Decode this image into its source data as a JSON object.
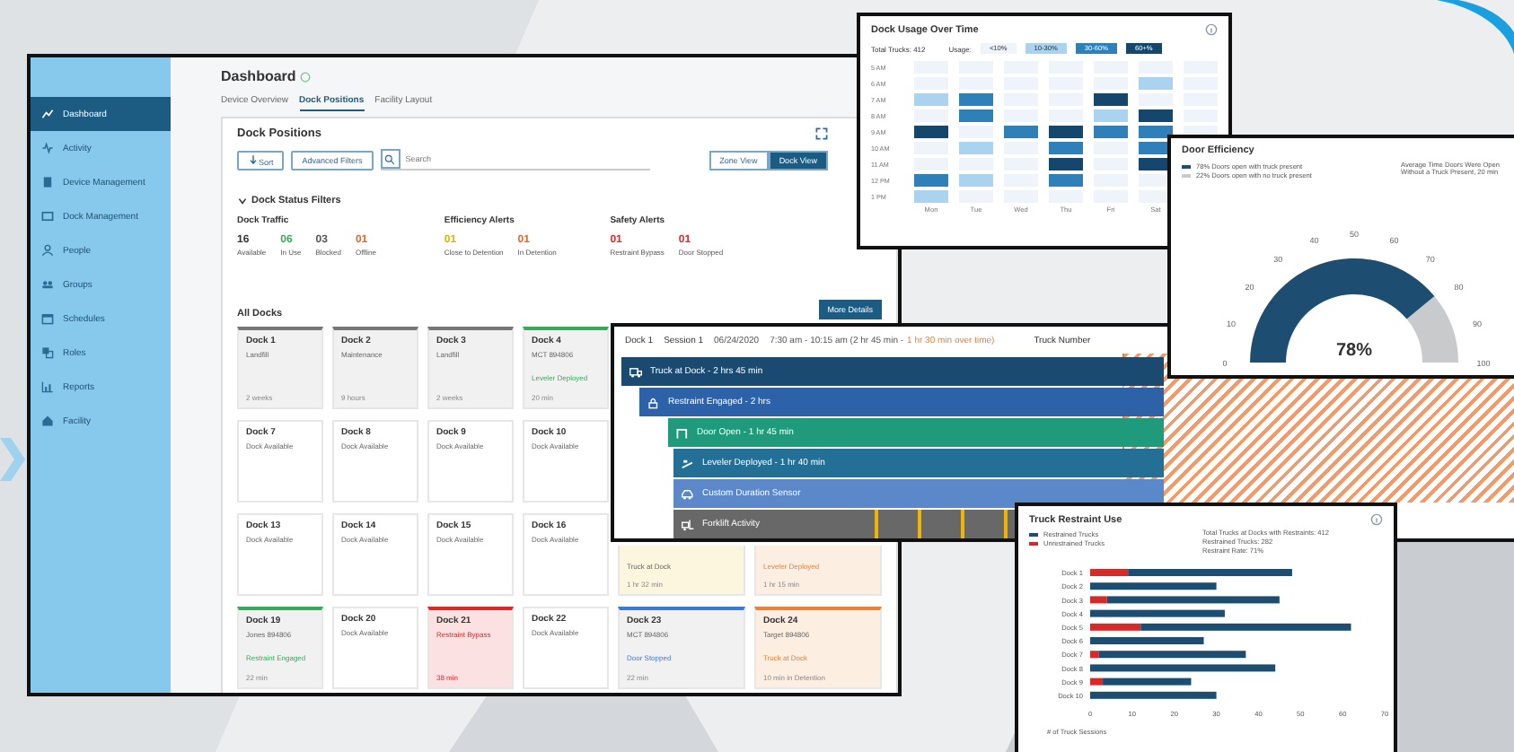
{
  "main": {
    "sidebar": {
      "items": [
        {
          "label": "Dashboard",
          "selected": true
        },
        {
          "label": "Activity",
          "selected": false
        },
        {
          "label": "Device Management",
          "selected": false
        },
        {
          "label": "Dock Management",
          "selected": false
        },
        {
          "label": "People",
          "selected": false
        },
        {
          "label": "Groups",
          "selected": false
        },
        {
          "label": "Schedules",
          "selected": false
        },
        {
          "label": "Roles",
          "selected": false
        },
        {
          "label": "Reports",
          "selected": false
        },
        {
          "label": "Facility",
          "selected": false
        }
      ]
    },
    "title": "Dashboard",
    "tabs": [
      {
        "label": "Device Overview",
        "selected": false
      },
      {
        "label": "Dock Positions",
        "selected": true
      },
      {
        "label": "Facility Layout",
        "selected": false
      }
    ],
    "panel_title": "Dock Positions",
    "toolbar": {
      "sort": "Sort",
      "filters": "Advanced Filters",
      "search_placeholder": "Search",
      "views": [
        {
          "label": "Zone View",
          "selected": false
        },
        {
          "label": "Dock View",
          "selected": true
        }
      ]
    },
    "filters_title": "Dock Status Filters",
    "groups": [
      {
        "title": "Dock Traffic",
        "stats": [
          {
            "value": "16",
            "label": "Available",
            "color": "#333333"
          },
          {
            "value": "06",
            "label": "In Use",
            "color": "#3aa85a"
          },
          {
            "value": "03",
            "label": "Blocked",
            "color": "#555555"
          },
          {
            "value": "01",
            "label": "Offline",
            "color": "#e8652a"
          }
        ]
      },
      {
        "title": "Efficiency Alerts",
        "stats": [
          {
            "value": "01",
            "label": "Close to Detention",
            "color": "#e2b100"
          },
          {
            "value": "01",
            "label": "In Detention",
            "color": "#e8652a"
          }
        ]
      },
      {
        "title": "Safety Alerts",
        "stats": [
          {
            "value": "01",
            "label": "Restraint Bypass",
            "color": "#d62b2b"
          },
          {
            "value": "01",
            "label": "Door Stopped",
            "color": "#d62b2b"
          }
        ]
      }
    ],
    "more_button": "More Details",
    "all_docks": "All Docks",
    "docks": [
      {
        "kind": "gray",
        "title": "Dock 1",
        "sub": "Landfill",
        "time": "2 weeks"
      },
      {
        "kind": "gray",
        "title": "Dock 2",
        "sub": "Maintenance",
        "time": "9 hours"
      },
      {
        "kind": "gray",
        "title": "Dock 3",
        "sub": "Landfill",
        "time": "2 weeks"
      },
      {
        "kind": "green",
        "title": "Dock 4",
        "sub": "MCT  894806",
        "status": "Leveler Deployed",
        "time": "20 min"
      },
      {
        "kind": "hidden"
      },
      {
        "kind": "hidden"
      },
      {
        "kind": "white",
        "title": "Dock 7",
        "sub": "Dock Available"
      },
      {
        "kind": "white",
        "title": "Dock 8",
        "sub": "Dock Available"
      },
      {
        "kind": "white",
        "title": "Dock 9",
        "sub": "Dock Available"
      },
      {
        "kind": "white",
        "title": "Dock 10",
        "sub": "Dock Available"
      },
      {
        "kind": "hidden"
      },
      {
        "kind": "hidden"
      },
      {
        "kind": "white",
        "title": "Dock 13",
        "sub": "Dock Available"
      },
      {
        "kind": "white",
        "title": "Dock 14",
        "sub": "Dock Available"
      },
      {
        "kind": "white",
        "title": "Dock 15",
        "sub": "Dock Available"
      },
      {
        "kind": "white",
        "title": "Dock 16",
        "sub": "Dock Available"
      },
      {
        "kind": "yellow",
        "status": "Truck at Dock",
        "time": "1 hr 32 min"
      },
      {
        "kind": "orange",
        "status": "Leveler Deployed",
        "time": "1 hr 15 min"
      },
      {
        "kind": "green",
        "title": "Dock 19",
        "sub": "Jones  894806",
        "status": "Restraint Engaged",
        "time": "22 min"
      },
      {
        "kind": "white",
        "title": "Dock 20",
        "sub": "Dock Available"
      },
      {
        "kind": "red",
        "title": "Dock 21",
        "sub": "Restraint Bypass",
        "time": "38 min"
      },
      {
        "kind": "white",
        "title": "Dock 22",
        "sub": "Dock Available"
      },
      {
        "kind": "blue",
        "title": "Dock 23",
        "sub": "MCT  894806",
        "status": "Door Stopped",
        "time": "22 min"
      },
      {
        "kind": "orange",
        "title": "Dock 24",
        "sub": "Target  894806",
        "status": "Truck at Dock",
        "time": "10 min in Detention"
      }
    ]
  },
  "usage": {
    "title": "Dock Usage Over Time",
    "total": "Total Trucks: 412",
    "usage_label": "Usage:",
    "legend": [
      {
        "label": "<10%",
        "color": "#eef4fa"
      },
      {
        "label": "10-30%",
        "color": "#a9d3ee"
      },
      {
        "label": "30-60%",
        "color": "#2f7fb8"
      },
      {
        "label": "60+%",
        "color": "#15466b"
      }
    ],
    "rows": [
      {
        "label": "5 AM",
        "cells": [
          {
            "color": "#eef4fa"
          },
          {
            "color": "#eef4fa"
          },
          {
            "color": "#eef4fa"
          },
          {
            "color": "#eef4fa"
          },
          {
            "color": "#eef4fa"
          },
          {
            "color": "#eef4fa"
          },
          {
            "color": "#eef4fa"
          }
        ]
      },
      {
        "label": "6 AM",
        "cells": [
          {
            "color": "#eef4fa"
          },
          {
            "color": "#eef4fa"
          },
          {
            "color": "#eef4fa"
          },
          {
            "color": "#eef4fa"
          },
          {
            "color": "#eef4fa"
          },
          {
            "color": "#a9d3ee"
          },
          {
            "color": "#eef4fa"
          }
        ]
      },
      {
        "label": "7 AM",
        "cells": [
          {
            "color": "#a9d3ee"
          },
          {
            "color": "#2f7fb8"
          },
          {
            "color": "#eef4fa"
          },
          {
            "color": "#eef4fa"
          },
          {
            "color": "#15466b"
          },
          {
            "color": "#eef4fa"
          },
          {
            "color": "#eef4fa"
          }
        ]
      },
      {
        "label": "8 AM",
        "cells": [
          {
            "color": "#eef4fa"
          },
          {
            "color": "#2f7fb8"
          },
          {
            "color": "#eef4fa"
          },
          {
            "color": "#eef4fa"
          },
          {
            "color": "#a9d3ee"
          },
          {
            "color": "#15466b"
          },
          {
            "color": "#eef4fa"
          }
        ]
      },
      {
        "label": "9 AM",
        "cells": [
          {
            "color": "#15466b"
          },
          {
            "color": "#eef4fa"
          },
          {
            "color": "#2f7fb8"
          },
          {
            "color": "#15466b"
          },
          {
            "color": "#2f7fb8"
          },
          {
            "color": "#2f7fb8"
          },
          {
            "color": "#eef4fa"
          }
        ]
      },
      {
        "label": "10 AM",
        "cells": [
          {
            "color": "#eef4fa"
          },
          {
            "color": "#a9d3ee"
          },
          {
            "color": "#eef4fa"
          },
          {
            "color": "#2f7fb8"
          },
          {
            "color": "#eef4fa"
          },
          {
            "color": "#2f7fb8"
          }
        ]
      },
      {
        "label": "11 AM",
        "cells": [
          {
            "color": "#eef4fa"
          },
          {
            "color": "#eef4fa"
          },
          {
            "color": "#eef4fa"
          },
          {
            "color": "#15466b"
          },
          {
            "color": "#eef4fa"
          },
          {
            "color": "#15466b"
          }
        ]
      },
      {
        "label": "12 PM",
        "cells": [
          {
            "color": "#2f7fb8"
          },
          {
            "color": "#a9d3ee"
          },
          {
            "color": "#eef4fa"
          },
          {
            "color": "#2f7fb8"
          },
          {
            "color": "#eef4fa"
          },
          {
            "color": "#eef4fa"
          }
        ]
      },
      {
        "label": "1 PM",
        "cells": [
          {
            "color": "#a9d3ee"
          },
          {
            "color": "#eef4fa"
          },
          {
            "color": "#eef4fa"
          },
          {
            "color": "#eef4fa"
          },
          {
            "color": "#eef4fa"
          },
          {
            "color": "#eef4fa"
          }
        ]
      }
    ],
    "days": [
      "Mon",
      "Tue",
      "Wed",
      "Thu",
      "Fri",
      "Sat"
    ]
  },
  "efficiency": {
    "title": "Door Efficiency",
    "legend": [
      {
        "text": "78% Doors open with truck present",
        "color": "#1d4e72"
      },
      {
        "text": "22% Doors open with no truck present",
        "color": "#c8cacc"
      }
    ],
    "note": [
      "Average Time Doors Were Open",
      "Without a Truck Present, 20 min"
    ],
    "ticks": [
      "0",
      "10",
      "20",
      "30",
      "40",
      "50",
      "60",
      "70",
      "80",
      "90",
      "100"
    ],
    "reading": "78%"
  },
  "session": {
    "dock": "Dock 1",
    "session": "Session 1",
    "date": "06/24/2020",
    "time_range": "7:30 am - 10:15 am (2 hr 45 min -",
    "overtime": "1 hr 30 min over time)",
    "truck": "Truck Number",
    "bars": [
      {
        "kind": "span",
        "label": "Truck at Dock - 2 hrs 45 min",
        "color": "#1b4a70"
      },
      {
        "kind": "span",
        "label": "Restraint Engaged - 2 hrs",
        "color": "#2d62a8"
      },
      {
        "kind": "span",
        "label": "Door Open - 1 hr 45 min",
        "color": "#1f9a7a"
      },
      {
        "kind": "span",
        "label": "Leveler Deployed - 1 hr 40 min",
        "color": "#236f96"
      },
      {
        "kind": "span",
        "label": "Custom Duration Sensor",
        "color": "#5a88c8"
      },
      {
        "kind": "activity",
        "label": "Forklift Activity",
        "color": "#686868"
      }
    ]
  },
  "restraint": {
    "title": "Truck Restraint Use",
    "summary": [
      "Total Trucks at Docks with Restraints: 412",
      "Restrained Trucks: 282",
      "Restraint Rate: 71%"
    ],
    "chart_data": {
      "type": "bar",
      "orientation": "horizontal",
      "stacked": true,
      "xlabel": "# of Truck Sessions",
      "xlim": [
        0,
        70
      ],
      "xticks": [
        0,
        10,
        20,
        30,
        40,
        50,
        60,
        70
      ],
      "categories": [
        "Dock 1",
        "Dock 2",
        "Dock 3",
        "Dock 4",
        "Dock 5",
        "Dock 6",
        "Dock 7",
        "Dock 8",
        "Dock 9",
        "Dock 10"
      ],
      "series": [
        {
          "name": "Restrained Trucks",
          "color": "#1d4e72",
          "values": [
            39,
            30,
            41,
            32,
            50,
            27,
            35,
            44,
            21,
            30
          ]
        },
        {
          "name": "Unrestrained Trucks",
          "color": "#d42a2a",
          "values": [
            9,
            0,
            4,
            0,
            12,
            0,
            2,
            0,
            3,
            0
          ]
        }
      ]
    }
  }
}
